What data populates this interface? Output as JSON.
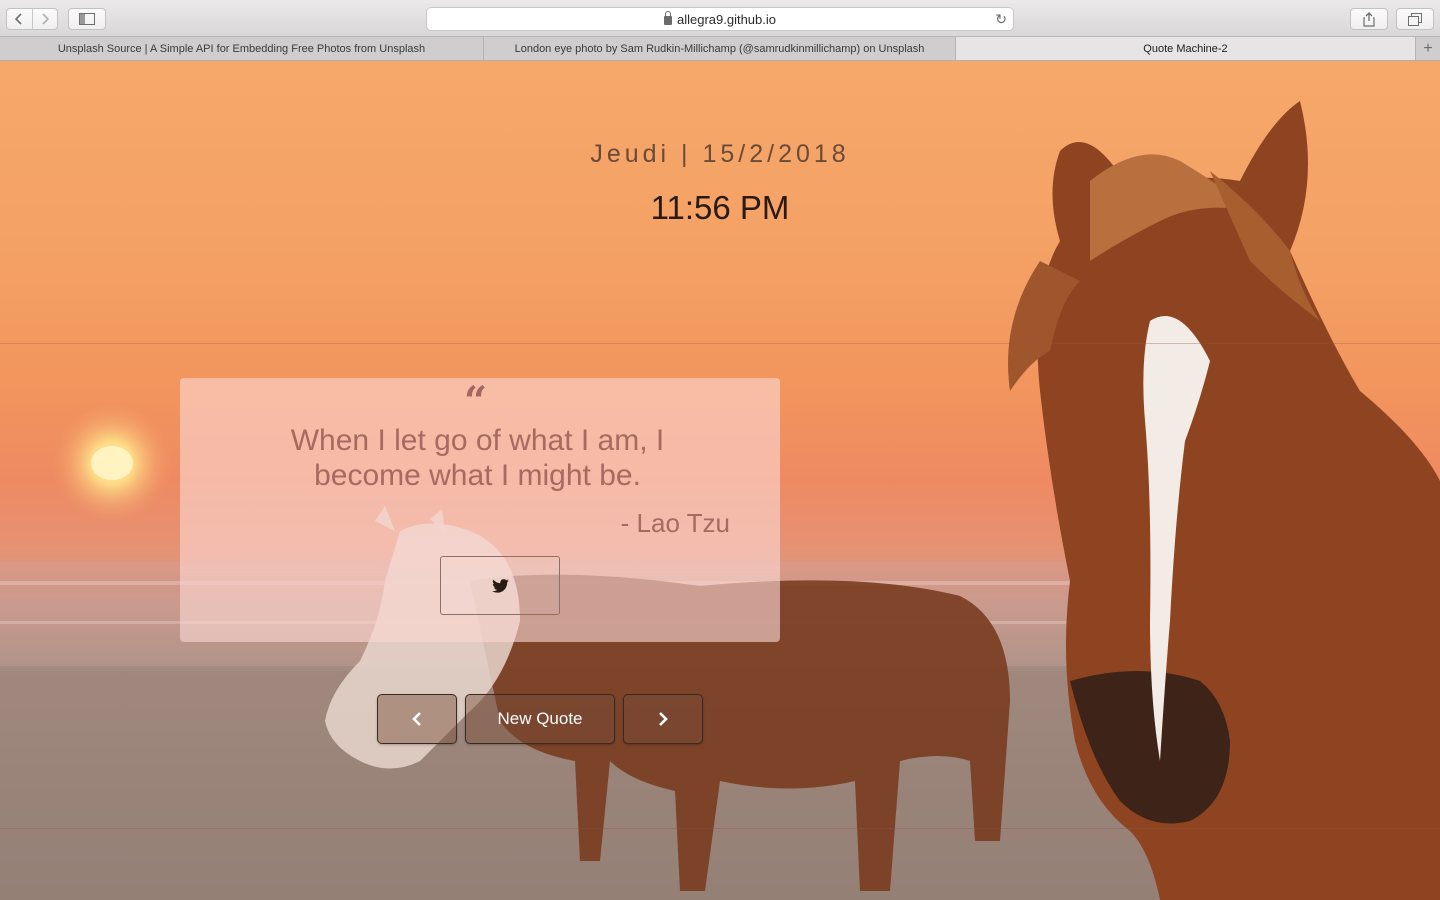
{
  "browser": {
    "url": "allegra9.github.io",
    "tabs": [
      {
        "title": "Unsplash Source | A Simple API for Embedding Free Photos from Unsplash"
      },
      {
        "title": "London eye photo by Sam Rudkin-Millichamp (@samrudkinmillichamp) on Unsplash"
      },
      {
        "title": "Quote Machine-2",
        "active": true
      }
    ]
  },
  "clock": {
    "date": "Jeudi | 15/2/2018",
    "time": "11:56 PM"
  },
  "quote": {
    "text": "When I let go of what I am, I become what I might be.",
    "author": "- Lao Tzu"
  },
  "controls": {
    "new_quote_label": "New Quote"
  },
  "icons": [
    "back-icon",
    "forward-icon",
    "sidebar-icon",
    "lock-icon",
    "reload-icon",
    "share-icon",
    "tabs-icon",
    "plus-icon",
    "quote-icon",
    "twitter-icon",
    "chevron-left-icon",
    "chevron-right-icon"
  ]
}
